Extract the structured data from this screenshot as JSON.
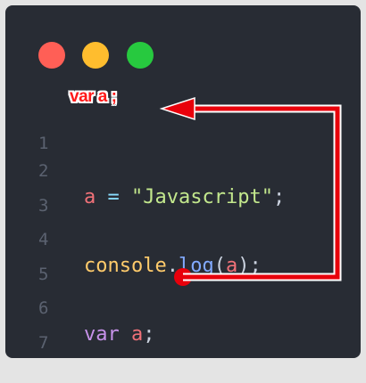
{
  "window": {
    "controls": [
      {
        "name": "close",
        "color": "#ff5f56"
      },
      {
        "name": "minimize",
        "color": "#ffbd2e"
      },
      {
        "name": "maximize",
        "color": "#27c93f"
      }
    ]
  },
  "editor": {
    "line_numbers": [
      "1",
      "2",
      "3",
      "4",
      "5",
      "6",
      "7"
    ],
    "line2": {
      "name": "a",
      "op": "=",
      "string": "\"Javascript\"",
      "end": ";"
    },
    "line4": {
      "object": "console",
      "dot": ".",
      "method": "log",
      "open": "(",
      "arg": "a",
      "close": ")",
      "end": ";"
    },
    "line6": {
      "keyword": "var",
      "name": "a",
      "end": ";"
    }
  },
  "annotation": {
    "label": "var a ;",
    "arrow_color": "#e8000b"
  }
}
